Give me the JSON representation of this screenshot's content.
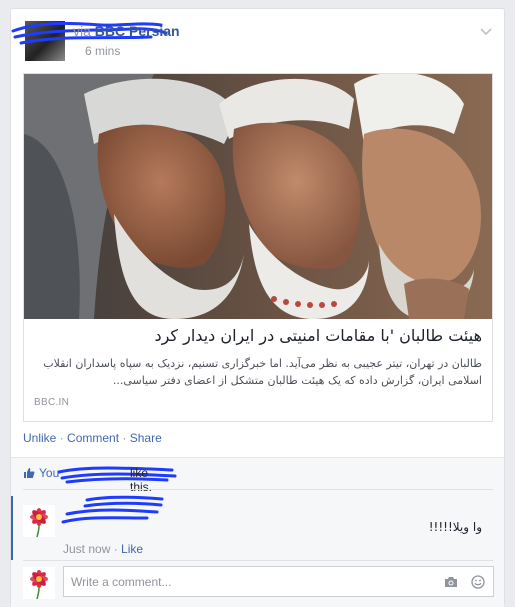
{
  "post": {
    "via_label": "via",
    "page_name": "BBC Persian",
    "timestamp": "6 mins",
    "chevron_icon": "chevron-down-icon"
  },
  "link": {
    "headline": "هیئت طالبان 'با مقامات امنیتی در ایران دیدار کرد",
    "summary": "طالبان در تهران، تیتر عجیبی به نظر می‌آید. اما خبرگزاری تسنیم، نزدیک به سپاه پاسداران انقلاب اسلامی ایران، گزارش داده که یک هیئت طالبان متشکل از اعضای دفتر سیاسی...",
    "domain": "BBC.IN"
  },
  "actions": {
    "unlike": "Unlike",
    "comment": "Comment",
    "share": "Share",
    "separator": "·"
  },
  "likes": {
    "you": "You",
    "suffix": "like this."
  },
  "comment": {
    "text": "وا ویلا!!!!!",
    "time": "Just now",
    "like": "Like"
  },
  "composer": {
    "placeholder": "Write a comment..."
  },
  "colors": {
    "link_blue": "#4267b2",
    "page_blue": "#365899",
    "meta_gray": "#90949c",
    "scribble_blue": "#1f3bff"
  }
}
